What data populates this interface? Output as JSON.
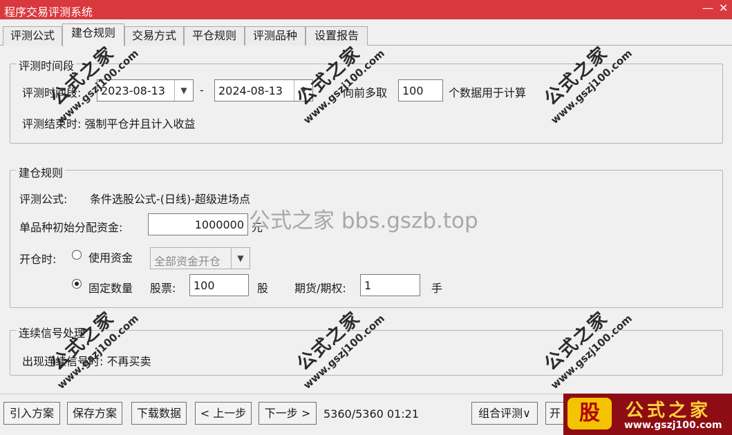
{
  "window": {
    "title": "程序交易评测系统",
    "minimize": "—",
    "close": "✕"
  },
  "tabs": [
    "评测公式",
    "建仓规则",
    "交易方式",
    "平仓规则",
    "评测品种",
    "设置报告"
  ],
  "period": {
    "legend": "评测时间段",
    "label": "评测时间段:",
    "start_date": "2023-08-13",
    "dash": "-",
    "end_date": "2024-08-13",
    "lookback_prefix": "向前多取",
    "lookback_value": "100",
    "lookback_suffix": "个数据用于计算",
    "end_note": "评测结束时: 强制平仓并且计入收益"
  },
  "build": {
    "legend": "建仓规则",
    "formula_label": "评测公式:",
    "formula_value": "条件选股公式-(日线)-超级进场点",
    "capital_label": "单品种初始分配资金:",
    "capital_value": "1000000",
    "capital_unit": "元",
    "open_label": "开仓时:",
    "use_capital_label": "使用资金",
    "capital_mode": "全部资金开仓",
    "fixed_qty_label": "固定数量",
    "stock_label": "股票:",
    "stock_qty": "100",
    "stock_unit": "股",
    "futures_label": "期货/期权:",
    "futures_qty": "1",
    "futures_unit": "手",
    "selected_mode": "fixed"
  },
  "signal": {
    "legend": "连续信号处理",
    "text": "出现连续信号时: 不再买卖"
  },
  "buttons": {
    "import": "引入方案",
    "save": "保存方案",
    "download": "下载数据",
    "prev": "< 上一步",
    "next": "下一步 >",
    "progress": "5360/5360  01:21",
    "combo_eval": "组合评测∨",
    "start": "开"
  },
  "watermarks": {
    "cn": "公式之家",
    "url": "www.gszj100.com",
    "center": "公式之家 bbs.gszb.top",
    "logo_char": "股",
    "logo_cn": "公式之家",
    "logo_url": "www.gszj100.com"
  },
  "colors": {
    "titlebar": "#d9383e",
    "logo_bg": "#8e0d14",
    "logo_gold": "#ffd23a"
  }
}
